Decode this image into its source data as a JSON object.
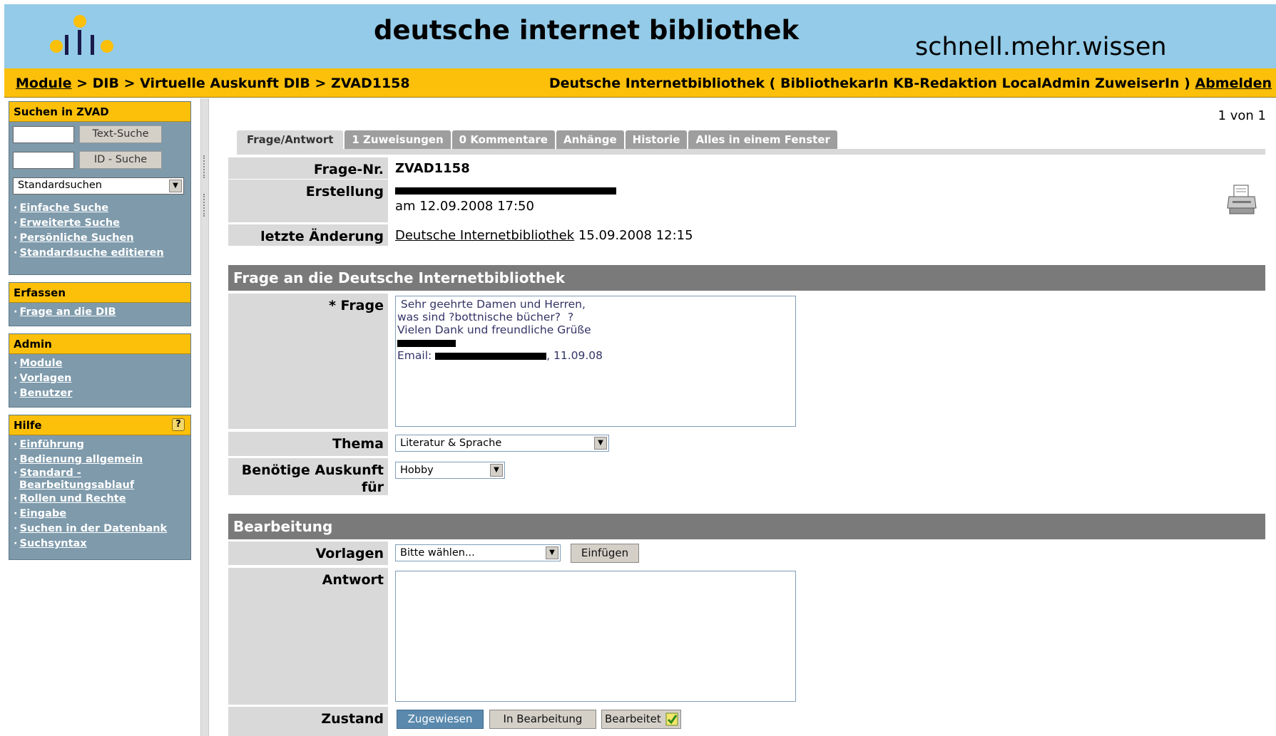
{
  "header": {
    "title": "deutsche internet bibliothek",
    "tagline": "schnell.mehr.wissen"
  },
  "topbar": {
    "breadcrumb_link": "Module",
    "breadcrumb_rest": " > DIB > Virtuelle Auskunft DIB > ZVAD1158",
    "user_text": "Deutsche Internetbibliothek ( BibliothekarIn KB-Redaktion LocalAdmin ZuweiserIn ) ",
    "logout": "Abmelden"
  },
  "sidebar": {
    "search": {
      "title": "Suchen in ZVAD",
      "text_search_btn": "Text-Suche",
      "id_search_btn": "ID - Suche",
      "select_value": "Standardsuchen",
      "links": [
        "Einfache Suche",
        "Erweiterte Suche",
        "Persönliche Suchen",
        "Standardsuche editieren"
      ]
    },
    "erfassen": {
      "title": "Erfassen",
      "links": [
        "Frage an die DIB"
      ]
    },
    "admin": {
      "title": "Admin",
      "links": [
        "Module",
        "Vorlagen",
        "Benutzer"
      ]
    },
    "hilfe": {
      "title": "Hilfe",
      "badge": "?",
      "links": [
        "Einführung",
        "Bedienung allgemein",
        "Standard -",
        "Bearbeitungsablauf",
        "Rollen und Rechte",
        "Eingabe",
        "Suchen in der Datenbank",
        "Suchsyntax"
      ]
    }
  },
  "main": {
    "pager": "1 von 1",
    "tabs": [
      "Frage/Antwort",
      "1 Zuweisungen",
      "0 Kommentare",
      "Anhänge",
      "Historie",
      "Alles in einem Fenster"
    ],
    "frage_nr_label": "Frage-Nr.",
    "frage_nr_value": "ZVAD1158",
    "erstellung_label": "Erstellung",
    "erstellung_date": "am 12.09.2008 17:50",
    "aenderung_label": "letzte Änderung",
    "aenderung_link": "Deutsche Internetbibliothek",
    "aenderung_date": " 15.09.2008 12:15",
    "section_frage": "Frage an die Deutsche Internetbibliothek",
    "frage_label": "* Frage",
    "frage_lines": [
      " Sehr geehrte Damen und Herren,",
      "was sind ?bottnische bücher?  ?",
      "Vielen Dank und freundliche Grüße",
      "",
      "Email: ",
      ", 11.09.08"
    ],
    "thema_label": "Thema",
    "thema_value": "Literatur & Sprache",
    "auskunft_label_1": "Benötige Auskunft",
    "auskunft_label_2": "für",
    "auskunft_value": "Hobby",
    "section_bearbeitung": "Bearbeitung",
    "vorlagen_label": "Vorlagen",
    "vorlagen_value": "Bitte wählen...",
    "einfuegen_btn": "Einfügen",
    "antwort_label": "Antwort",
    "antwort_value": "",
    "zustand_label": "Zustand",
    "zustand_btns": [
      "Zugewiesen",
      "In Bearbeitung",
      "Bearbeitet"
    ]
  },
  "colors": {
    "header_bg": "#93cbe8",
    "bar_bg": "#fcc00a",
    "sidebar_box": "#7e9aab",
    "section_bg": "#7a7a7a",
    "label_bg": "#d9d9d9"
  }
}
